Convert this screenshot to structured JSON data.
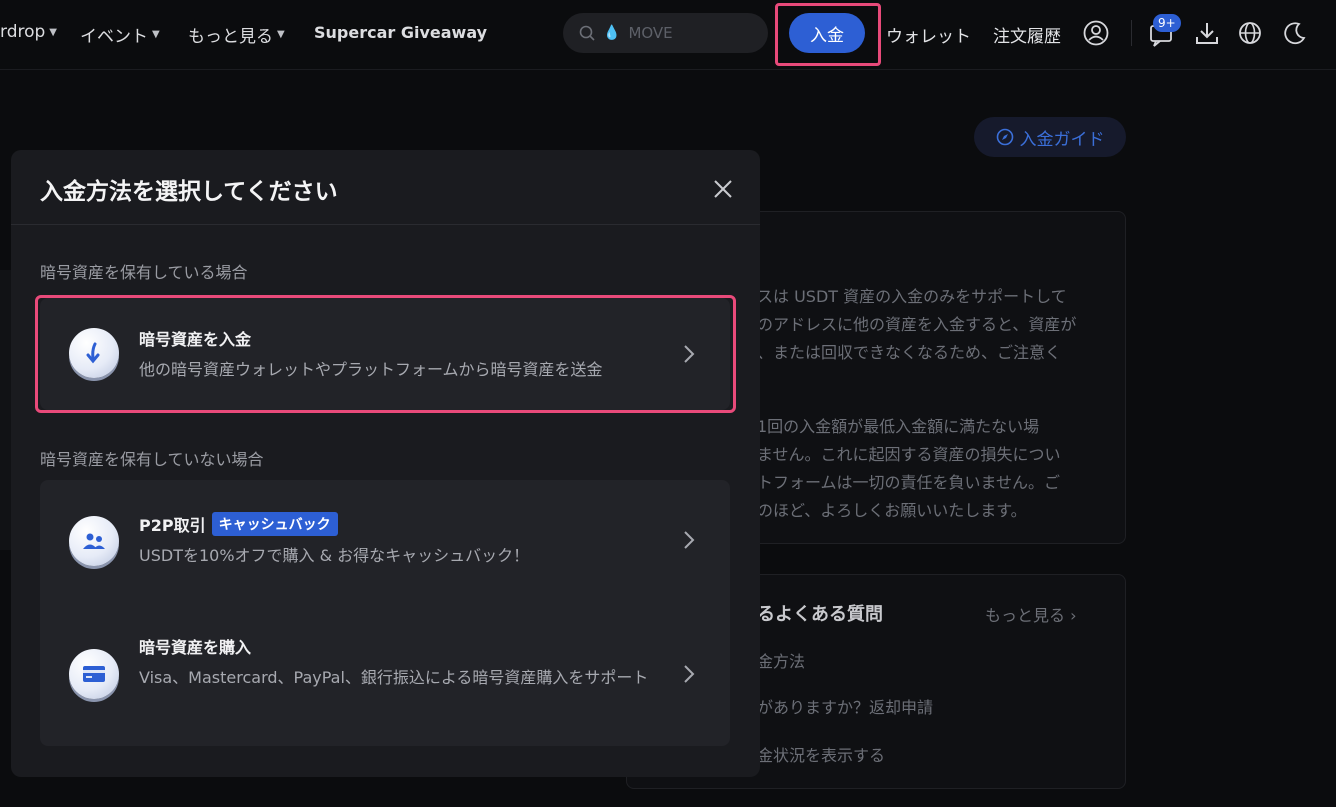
{
  "nav": {
    "items": [
      {
        "label": "rdrop"
      },
      {
        "label": "イベント"
      },
      {
        "label": "もっと見る"
      }
    ],
    "promo": "Supercar Giveaway",
    "search_placeholder": "MOVE",
    "deposit_button": "入金",
    "wallet": "ウォレット",
    "orders": "注文履歴",
    "notification_count": "9+"
  },
  "background": {
    "guide_button": "入金ガイド",
    "notice_lines": [
      "スは USDT 資産の入金のみをサポートして",
      "のアドレスに他の資産を入金すると、資産が",
      "、または回収できなくなるため、ご注意く"
    ],
    "notice_lines2": [
      "1回の入金額が最低入金額に満たない場",
      "ません。これに起因する資産の損失につい",
      "トフォームは一切の責任を負いません。ご",
      "のほど、よろしくお願いいたします。"
    ],
    "faq_title": "るよくある質問",
    "faq_more": "もっと見る",
    "faq_items": [
      "金方法",
      "がありますか？返却申請",
      "金状況を表示する"
    ]
  },
  "modal": {
    "title": "入金方法を選択してください",
    "section_have": "暗号資産を保有している場合",
    "section_not_have": "暗号資産を保有していない場合",
    "options": [
      {
        "title": "暗号資産を入金",
        "desc": "他の暗号資産ウォレットやプラットフォームから暗号資産を送金"
      },
      {
        "title": "P2P取引",
        "badge": "キャッシュバック",
        "desc": "USDTを10%オフで購入 & お得なキャッシュバック！"
      },
      {
        "title": "暗号資産を購入",
        "desc": "Visa、Mastercard、PayPal、銀行振込による暗号資産購入をサポート"
      }
    ]
  },
  "colors": {
    "accent": "#2d5fd4",
    "highlight": "#e84a7a",
    "modal_bg": "#1a1b1f"
  },
  "icons": [
    "search-icon",
    "water-drop-icon",
    "user-icon",
    "chat-icon",
    "download-icon",
    "globe-icon",
    "moon-icon",
    "compass-icon",
    "close-icon",
    "arrow-down-icon",
    "users-icon",
    "card-icon",
    "chevron-right-icon"
  ]
}
